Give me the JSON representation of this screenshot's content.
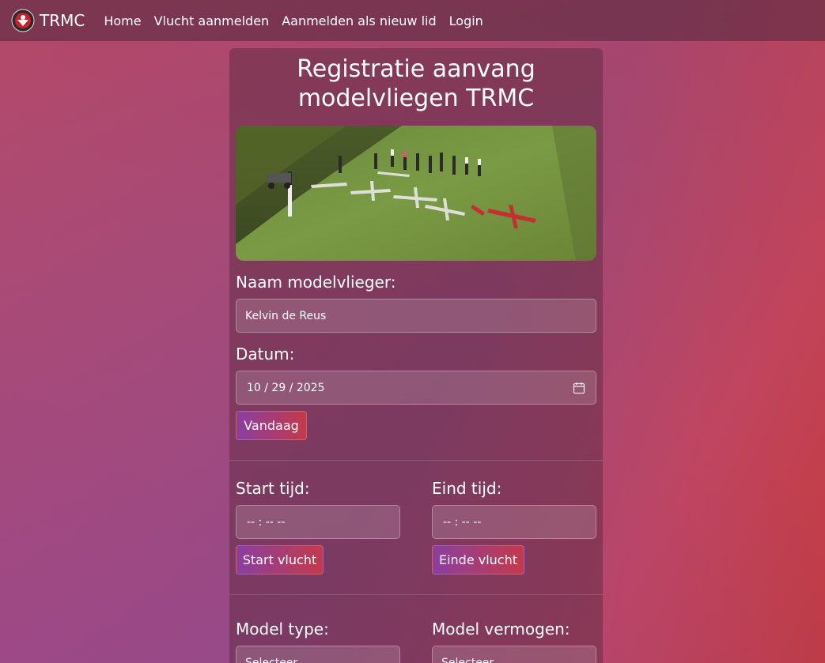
{
  "nav": {
    "brand": "TRMC",
    "links": [
      "Home",
      "Vlucht aanmelden",
      "Aanmelden als nieuw lid",
      "Login"
    ]
  },
  "page": {
    "title": "Registratie aanvang modelvliegen TRMC"
  },
  "form": {
    "name_label": "Naam modelvlieger:",
    "name_value": "Kelvin de Reus",
    "date_label": "Datum:",
    "date_value": "10 / 29 / 2025",
    "today_button": "Vandaag",
    "start_label": "Start tijd:",
    "start_value": "-- : --  --",
    "start_button": "Start vlucht",
    "end_label": "Eind tijd:",
    "end_value": "-- : --  --",
    "end_button": "Einde vlucht",
    "model_type_label": "Model type:",
    "model_type_value": "Selecteer",
    "model_power_label": "Model vermogen:",
    "model_power_value": "Selecteer"
  },
  "colors": {
    "accent_start": "#8a3fa0",
    "accent_end": "#c43a4a"
  },
  "icons": {
    "calendar": "calendar-icon",
    "logo": "club-logo-icon"
  }
}
